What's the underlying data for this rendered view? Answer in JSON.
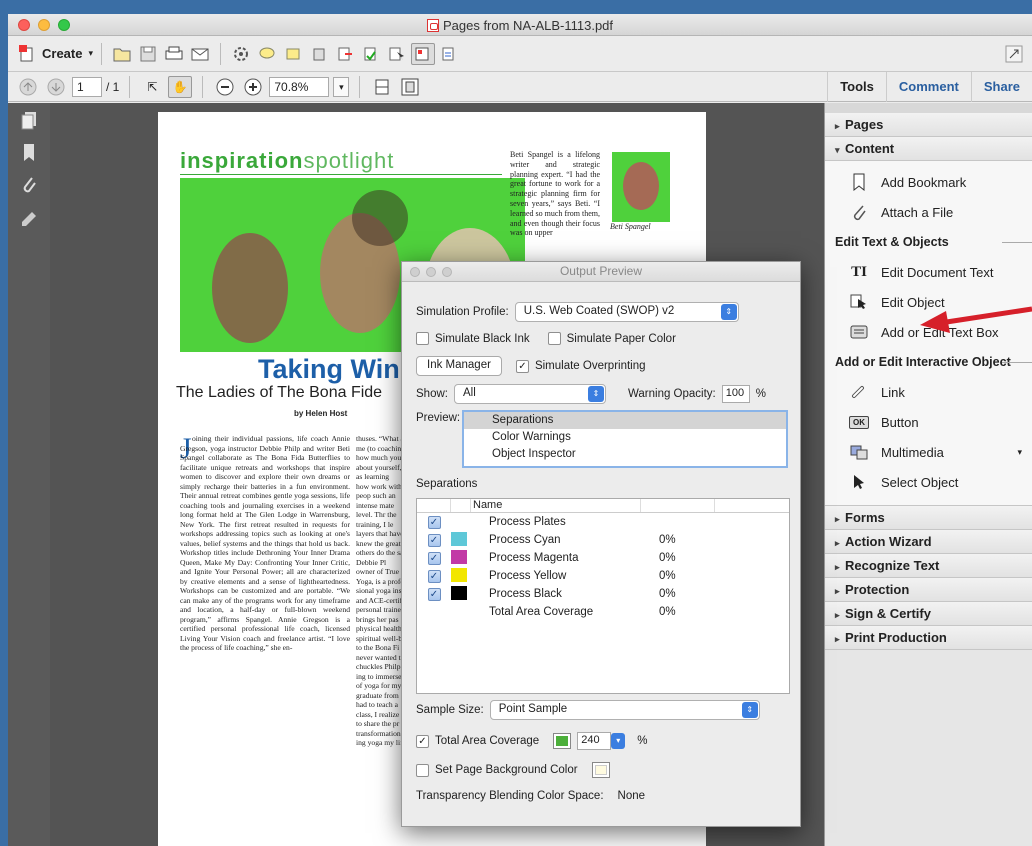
{
  "window": {
    "title": "Pages from NA-ALB-1113.pdf"
  },
  "toolbar": {
    "create_label": "Create",
    "page_current": "1",
    "page_total": "/ 1",
    "zoom": "70.8%"
  },
  "tabs": [
    {
      "label": "Tools"
    },
    {
      "label": "Comment"
    },
    {
      "label": "Share"
    }
  ],
  "panel": {
    "sections_top": [
      {
        "label": "Pages"
      },
      {
        "label": "Content"
      }
    ],
    "content_items": [
      {
        "label": "Add Bookmark",
        "icon": "bookmark-icon"
      },
      {
        "label": "Attach a File",
        "icon": "paperclip-icon"
      }
    ],
    "group_edit": "Edit Text & Objects",
    "edit_items": [
      {
        "label": "Edit Document Text",
        "icon": "text-cursor-icon"
      },
      {
        "label": "Edit Object",
        "icon": "edit-object-icon"
      },
      {
        "label": "Add or Edit Text Box",
        "icon": "textbox-icon"
      }
    ],
    "group_interactive": "Add or Edit Interactive Object",
    "interactive_items": [
      {
        "label": "Link",
        "icon": "link-icon"
      },
      {
        "label": "Button",
        "icon": "ok-button-icon"
      },
      {
        "label": "Multimedia",
        "icon": "multimedia-icon"
      },
      {
        "label": "Select Object",
        "icon": "arrow-select-icon"
      }
    ],
    "sections_bottom": [
      {
        "label": "Forms"
      },
      {
        "label": "Action Wizard"
      },
      {
        "label": "Recognize Text"
      },
      {
        "label": "Protection"
      },
      {
        "label": "Sign & Certify"
      },
      {
        "label": "Print Production"
      }
    ]
  },
  "document": {
    "masthead_a": "inspiration",
    "masthead_b": "spotlight",
    "headline": "Taking Win",
    "subhead": "The Ladies of The Bona Fide",
    "byline": "by Helen Host",
    "sidebar_text": "Beti Spangel is a lifelong writer and strategic planning expert. “I had the great fortune to work for a strategic planning firm for seven years,” says Beti. “I learned so much from them, and even though their focus was on upper",
    "caption": "Beti Spangel",
    "col1": "oining their individual passions, life coach Annie Gregson, yoga instructor Debbie Philp and writer Beti Spangel collaborate as The Bona Fida Butterflies to facilitate unique retreats and workshops that inspire women to discover and explore their own dreams or simply recharge their batteries in a fun environment. Their annual retreat combines gentle yoga sessions, life coaching tools and journaling exercises in a weekend long format held at The Glen Lodge in Warrensburg, New York. The first retreat resulted in requests for workshops addressing topics such as looking at one's values, belief systems and the things that hold us back. Workshop titles include Dethroning Your Inner Drama Queen, Make My Day: Confronting Your Inner Critic, and Ignite Your Personal Power; all are characterized by creative elements and a sense of lightheartedness. Workshops can be customized and are portable. “We can make any of the programs work for any timeframe and location, a half-day or full-blown weekend program,” affirms Spangel. Annie Gregson is a certified personal professional life coach, licensed Living Your Vision coach and freelance artist. “I love the process of life coaching,” she en-",
    "col2": "thuses. “What a me (to coachin how much you about yourself, as learning how work with peop such an intense mate level. Thr the training, I le layers that have knew the great others do the sa Debbie Pl owner of True Yoga, is a profe sional yoga ins and ACE-certif personal traine brings her pas physical health spiritual well-b to the Bona Fi never wanted t chuckles Philp ing to immerse of yoga for my graduate from I had to teach a class, I realize to share the pr transformation ing yoga my lif"
  },
  "dialog": {
    "title": "Output Preview",
    "sim_profile_label": "Simulation Profile:",
    "sim_profile_value": "U.S. Web Coated (SWOP) v2",
    "simulate_black": "Simulate Black Ink",
    "simulate_paper": "Simulate Paper Color",
    "ink_manager": "Ink Manager",
    "simulate_overprint": "Simulate Overprinting",
    "show_label": "Show:",
    "show_value": "All",
    "warning_label": "Warning Opacity:",
    "warning_value": "100",
    "warning_unit": "%",
    "preview_label": "Preview:",
    "preview_options": [
      "Separations",
      "Color Warnings",
      "Object Inspector"
    ],
    "separations_label": "Separations",
    "col_name": "Name",
    "rows": [
      {
        "name": "Process Plates",
        "pct": "",
        "color": ""
      },
      {
        "name": "Process Cyan",
        "pct": "0%",
        "color": "#5ec8d8"
      },
      {
        "name": "Process Magenta",
        "pct": "0%",
        "color": "#c23aa6"
      },
      {
        "name": "Process Yellow",
        "pct": "0%",
        "color": "#f2e600"
      },
      {
        "name": "Process Black",
        "pct": "0%",
        "color": "#000000"
      },
      {
        "name": "Total Area Coverage",
        "pct": "0%",
        "color": ""
      }
    ],
    "sample_label": "Sample Size:",
    "sample_value": "Point Sample",
    "tac_label": "Total Area Coverage",
    "tac_value": "240",
    "tac_unit": "%",
    "bg_label": "Set Page Background Color",
    "blend_label": "Transparency Blending Color Space:",
    "blend_value": "None"
  },
  "colors": {
    "accent": "#2a5fa0",
    "headline": "#1d5fa8",
    "masthead": "#3aa83a",
    "photo_green": "#4fd13c",
    "arrow": "#d6202a"
  }
}
